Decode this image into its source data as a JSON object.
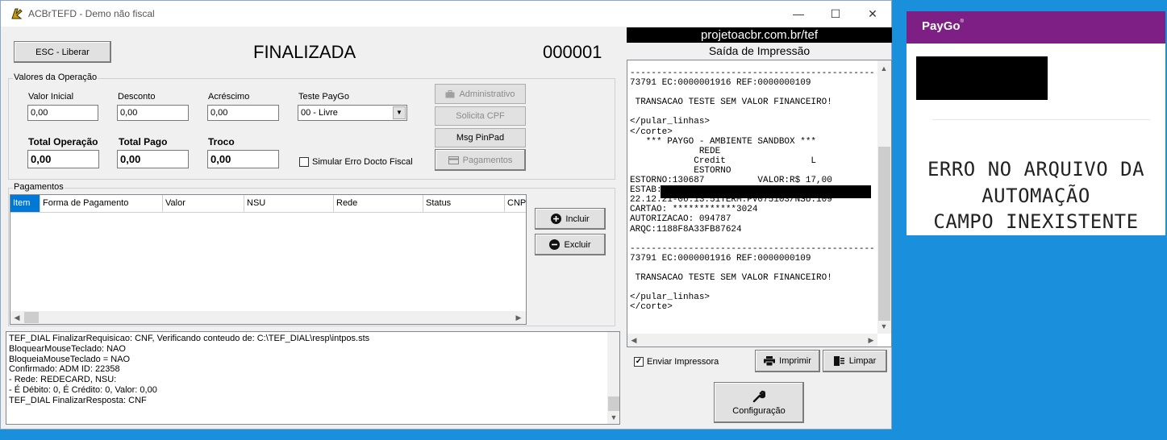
{
  "window": {
    "title": "ACBrTEFD - Demo não fiscal",
    "minimize": "—",
    "maximize": "☐",
    "close": "✕"
  },
  "top": {
    "esc_button": "ESC - Liberar",
    "status": "FINALIZADA",
    "counter": "000001"
  },
  "valores": {
    "group_label": "Valores da Operação",
    "valor_inicial_label": "Valor Inicial",
    "valor_inicial": "0,00",
    "desconto_label": "Desconto",
    "desconto": "0,00",
    "acrescimo_label": "Acréscimo",
    "acrescimo": "0,00",
    "teste_paygo_label": "Teste PayGo",
    "teste_paygo": "00 - Livre",
    "total_operacao_label": "Total Operação",
    "total_operacao": "0,00",
    "total_pago_label": "Total Pago",
    "total_pago": "0,00",
    "troco_label": "Troco",
    "troco": "0,00",
    "simular_label": "Simular Erro Docto Fiscal",
    "simular_checked": false,
    "administrativo": "Administrativo",
    "solicita_cpf": "Solicita CPF",
    "msg_pinpad": "Msg PinPad",
    "pagamentos_btn": "Pagamentos"
  },
  "pagamentos": {
    "group_label": "Pagamentos",
    "columns": [
      "Item",
      "Forma de Pagamento",
      "Valor",
      "NSU",
      "Rede",
      "Status",
      "CNPJ"
    ],
    "incluir": "Incluir",
    "excluir": "Excluir"
  },
  "log": {
    "lines": [
      "TEF_DIAL FinalizarRequisicao: CNF, Verificando conteudo de: C:\\TEF_DIAL\\resp\\intpos.sts",
      "BloquearMouseTeclado: NAO",
      "BloqueiaMouseTeclado = NAO",
      "Confirmado: ADM ID: 22358",
      "- Rede: REDECARD, NSU:",
      "- É Débito: 0, É Crédito: 0, Valor: 0,00",
      "TEF_DIAL FinalizarResposta: CNF"
    ]
  },
  "impressao": {
    "site": "projetoacbr.com.br/tef",
    "title": "Saída de Impressão",
    "receipt": "----------------------------------------------\n73791 EC:0000001916 REF:0000000109\n\n TRANSACAO TESTE SEM VALOR FINANCEIRO!\n\n</pular_linhas>\n</corte>\n   *** PAYGO - AMBIENTE SANDBOX ***\n             REDE\n            Credit                L\n            ESTORNO\nESTORNO:130687          VALOR:R$ 17,00\nESTAB:\n22.12.21-06:13:51TERM:PV075103/NSU:109\nCARTAO: ************3024\nAUTORIZACAO: 094787\nARQC:1188F8A33FB87624\n\n----------------------------------------------\n73791 EC:0000001916 REF:0000000109\n\n TRANSACAO TESTE SEM VALOR FINANCEIRO!\n\n</pular_linhas>\n</corte>",
    "enviar_label": "Enviar Impressora",
    "enviar_checked": true,
    "imprimir": "Imprimir",
    "limpar": "Limpar",
    "configuracao": "Configuração"
  },
  "paygo": {
    "logo": "PayGo",
    "logo_mark": "®",
    "message_lines": [
      "ERRO NO ARQUIVO DA",
      "AUTOMAÇÃO",
      "CAMPO INEXISTENTE"
    ],
    "brand_color": "#7e1f86"
  }
}
